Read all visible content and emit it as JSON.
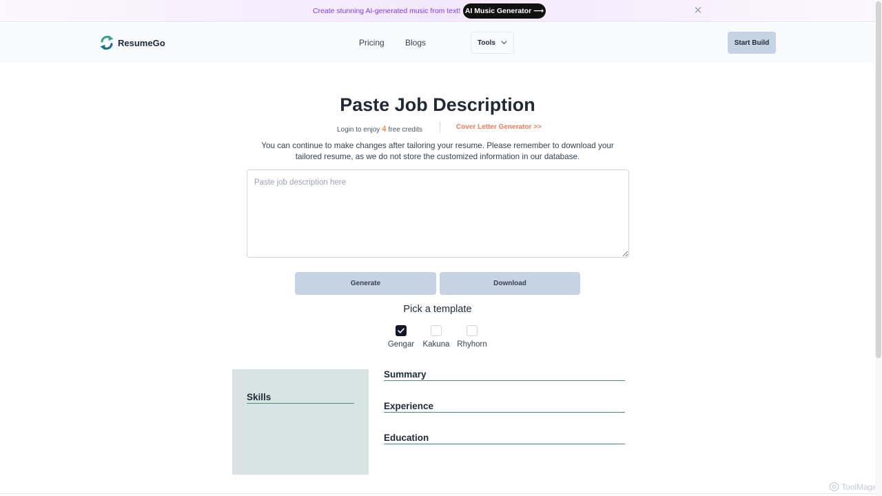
{
  "banner": {
    "text": "Create stunning AI-generated music from text!",
    "button_label": "AI Music Generator ⟶",
    "close_glyph": "✕"
  },
  "navbar": {
    "logo_text": "ResumeGo",
    "links": [
      "Pricing",
      "Blogs"
    ],
    "tools_label": "Tools",
    "start_label": "Start Build"
  },
  "main": {
    "title": "Paste Job Description",
    "credits_prefix": "Login to enjoy",
    "credits_count": "4",
    "credits_suffix": "free credits",
    "cover_link": "Cover Letter Generator >>",
    "info": "You can continue to make changes after tailoring your resume. Please remember to download your tailored resume, as we do not store the customized information in our database.",
    "textarea_placeholder": "Paste job description here",
    "textarea_value": "",
    "generate_label": "Generate",
    "download_label": "Download"
  },
  "templates": {
    "heading": "Pick a template",
    "items": [
      {
        "label": "Gengar",
        "checked": true
      },
      {
        "label": "Kakuna",
        "checked": false
      },
      {
        "label": "Rhyhorn",
        "checked": false
      }
    ]
  },
  "preview": {
    "side_sections": [
      "Skills"
    ],
    "main_sections": [
      "Summary",
      "Experience",
      "Education"
    ]
  },
  "watermark": "ToolMage",
  "colors": {
    "accent_orange": "#f97316",
    "cover_link": "#ef7b5c",
    "button_bg": "#c6d3e2",
    "preview_side_bg": "#d8e4e2",
    "heading_rule": "#4b8a7a"
  }
}
